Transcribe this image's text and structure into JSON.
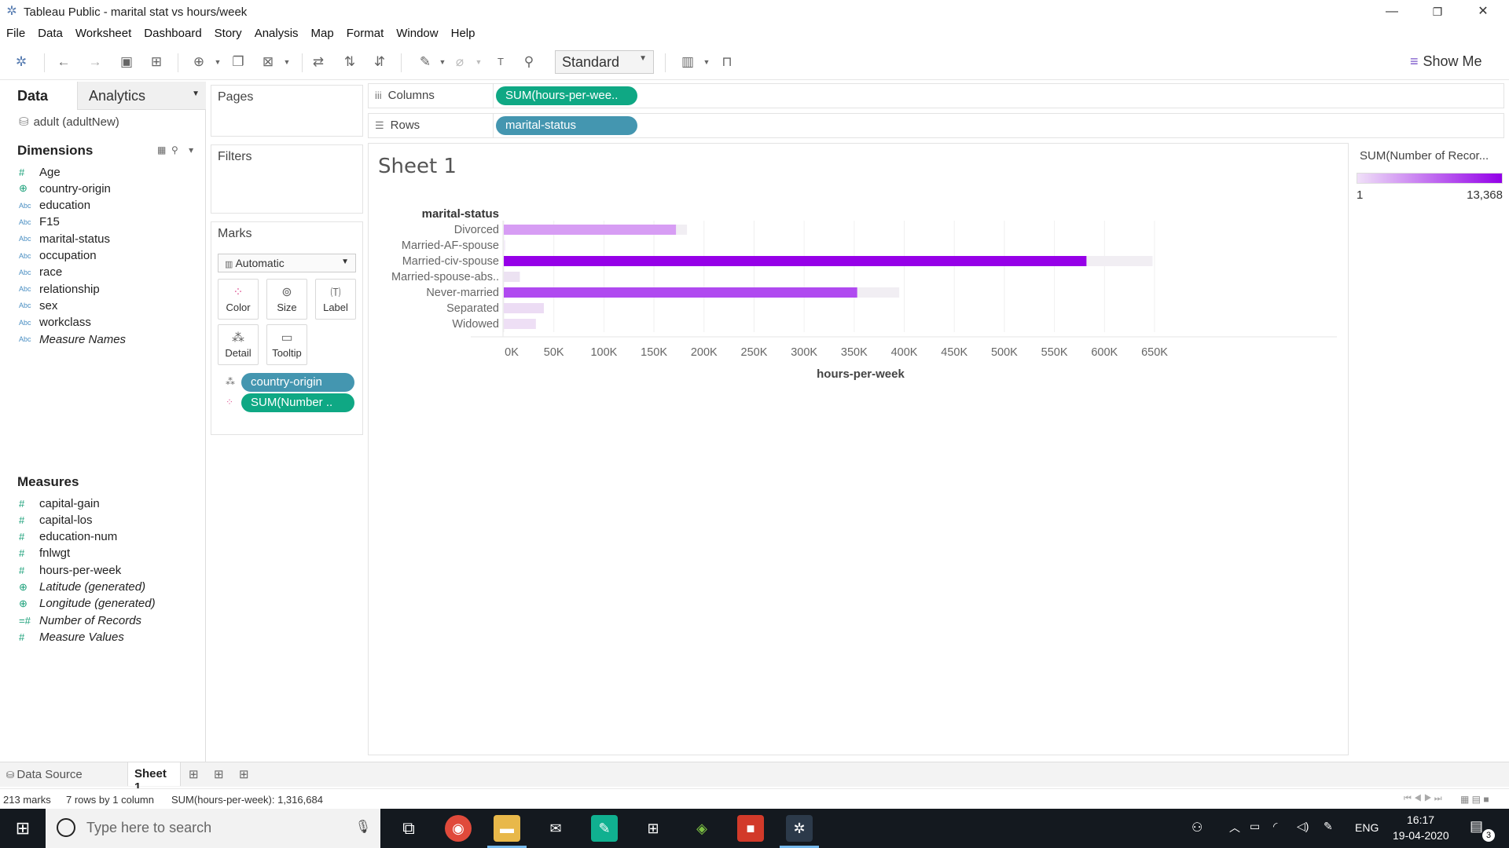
{
  "window": {
    "title": "Tableau Public - marital stat vs hours/week",
    "minimize": "—",
    "restore": "❐",
    "close": "✕"
  },
  "menu": [
    "File",
    "Data",
    "Worksheet",
    "Dashboard",
    "Story",
    "Analysis",
    "Map",
    "Format",
    "Window",
    "Help"
  ],
  "toolbar": {
    "fit_select": "Standard",
    "show_me": "Show Me"
  },
  "data_pane": {
    "tab_data": "Data",
    "tab_analytics": "Analytics",
    "datasource": "adult (adultNew)",
    "dimensions_title": "Dimensions",
    "dimensions": [
      {
        "type": "#",
        "label": "Age",
        "kind": "meas"
      },
      {
        "type": "⊕",
        "label": "country-origin",
        "kind": "geo"
      },
      {
        "type": "Abc",
        "label": "education",
        "kind": "dim"
      },
      {
        "type": "Abc",
        "label": "F15",
        "kind": "dim"
      },
      {
        "type": "Abc",
        "label": "marital-status",
        "kind": "dim"
      },
      {
        "type": "Abc",
        "label": "occupation",
        "kind": "dim"
      },
      {
        "type": "Abc",
        "label": "race",
        "kind": "dim"
      },
      {
        "type": "Abc",
        "label": "relationship",
        "kind": "dim"
      },
      {
        "type": "Abc",
        "label": "sex",
        "kind": "dim"
      },
      {
        "type": "Abc",
        "label": "workclass",
        "kind": "dim"
      },
      {
        "type": "Abc",
        "label": "Measure Names",
        "kind": "dim",
        "italic": true
      }
    ],
    "measures_title": "Measures",
    "measures": [
      {
        "type": "#",
        "label": "capital-gain",
        "kind": "meas"
      },
      {
        "type": "#",
        "label": "capital-los",
        "kind": "meas"
      },
      {
        "type": "#",
        "label": "education-num",
        "kind": "meas"
      },
      {
        "type": "#",
        "label": "fnlwgt",
        "kind": "meas"
      },
      {
        "type": "#",
        "label": "hours-per-week",
        "kind": "meas"
      },
      {
        "type": "⊕",
        "label": "Latitude (generated)",
        "kind": "geo",
        "italic": true
      },
      {
        "type": "⊕",
        "label": "Longitude (generated)",
        "kind": "geo",
        "italic": true
      },
      {
        "type": "=#",
        "label": "Number of Records",
        "kind": "meas",
        "italic": true
      },
      {
        "type": "#",
        "label": "Measure Values",
        "kind": "meas",
        "italic": true
      }
    ]
  },
  "cards": {
    "pages": "Pages",
    "filters": "Filters",
    "marks": "Marks",
    "mark_type": "Automatic",
    "buttons": [
      {
        "label": "Color",
        "icon": "color-icon"
      },
      {
        "label": "Size",
        "icon": "size-icon"
      },
      {
        "label": "Label",
        "icon": "label-icon"
      },
      {
        "label": "Detail",
        "icon": "detail-icon"
      },
      {
        "label": "Tooltip",
        "icon": "tooltip-icon"
      }
    ],
    "mark_pills": [
      {
        "label": "country-origin",
        "color": "#4496b0",
        "icon": "detail-icon"
      },
      {
        "label": "SUM(Number ..",
        "color": "#0fa884",
        "icon": "color-icon"
      }
    ]
  },
  "shelves": {
    "columns_label": "Columns",
    "columns_pill": "SUM(hours-per-wee..",
    "rows_label": "Rows",
    "rows_pill": "marital-status"
  },
  "sheet": {
    "title": "Sheet 1"
  },
  "chart_data": {
    "type": "bar",
    "orientation": "horizontal",
    "row_header": "marital-status",
    "categories": [
      "Divorced",
      "Married-AF-spouse",
      "Married-civ-spouse",
      "Married-spouse-abs..",
      "Never-married",
      "Separated",
      "Widowed"
    ],
    "total_values": [
      183000,
      1500,
      648000,
      16000,
      395000,
      40000,
      32000
    ],
    "highlighted_values": [
      172000,
      0,
      582000,
      0,
      353000,
      0,
      0
    ],
    "bar_colors": [
      "#d79df4",
      "#f5eef9",
      "#9600e8",
      "#ece2f2",
      "#b04af0",
      "#ecdcf4",
      "#eedff5"
    ],
    "xlabel": "hours-per-week",
    "xlim": [
      0,
      650000
    ],
    "xticks": [
      "0K",
      "50K",
      "100K",
      "150K",
      "200K",
      "250K",
      "300K",
      "350K",
      "400K",
      "450K",
      "500K",
      "550K",
      "600K",
      "650K"
    ],
    "grid": true
  },
  "legend": {
    "title": "SUM(Number of Recor...",
    "min": "1",
    "max": "13,368",
    "color_low": "#f0e0f8",
    "color_high": "#9300e8"
  },
  "tabs": {
    "datasource": "Data Source",
    "sheet": "Sheet 1"
  },
  "status": {
    "marks": "213 marks",
    "rows_cols": "7 rows by 1 column",
    "sum": "SUM(hours-per-week): 1,316,684"
  },
  "taskbar": {
    "search_placeholder": "Type here to search",
    "lang": "ENG",
    "time": "16:17",
    "date": "19-04-2020",
    "notif_count": "3"
  }
}
